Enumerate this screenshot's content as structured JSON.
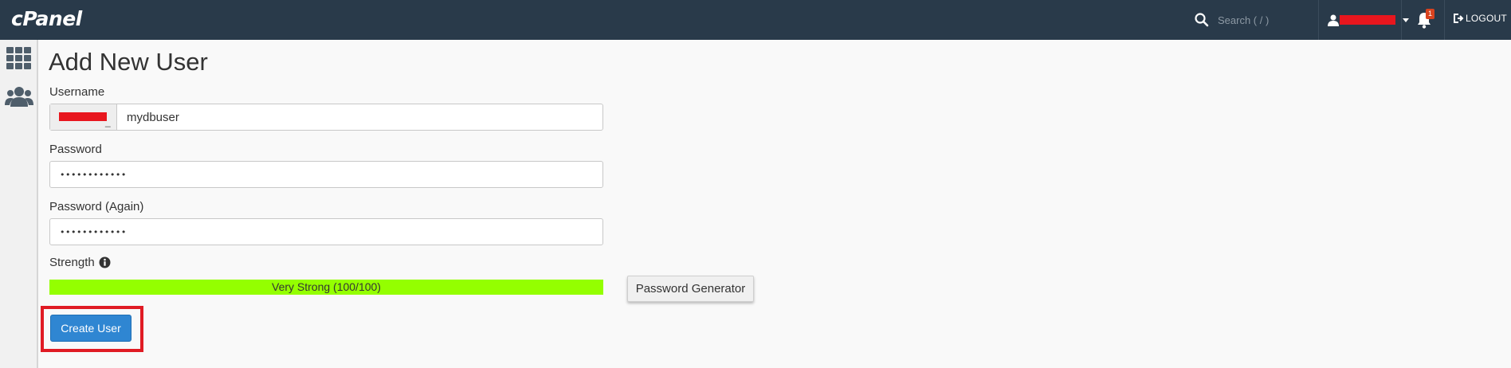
{
  "header": {
    "logo_text": "cPanel",
    "search": {
      "placeholder": "Search ( / )"
    },
    "notification_count": "1",
    "logout_label": "LOGOUT"
  },
  "sidebar": {
    "items": [
      {
        "icon": "grid-icon"
      },
      {
        "icon": "users-icon"
      }
    ]
  },
  "main": {
    "title": "Add New User",
    "username": {
      "label": "Username",
      "value": "mydbuser"
    },
    "password": {
      "label": "Password",
      "value": "••••••••••••"
    },
    "password_again": {
      "label": "Password (Again)",
      "value": "••••••••••••"
    },
    "strength": {
      "label": "Strength",
      "bar_text": "Very Strong (100/100)",
      "percent": 100,
      "color": "#94ff00"
    },
    "password_generator_label": "Password Generator",
    "create_user_label": "Create User"
  },
  "colors": {
    "topbar": "#293a4a",
    "primary_button": "#2f86d2",
    "highlight": "#e01b24"
  }
}
